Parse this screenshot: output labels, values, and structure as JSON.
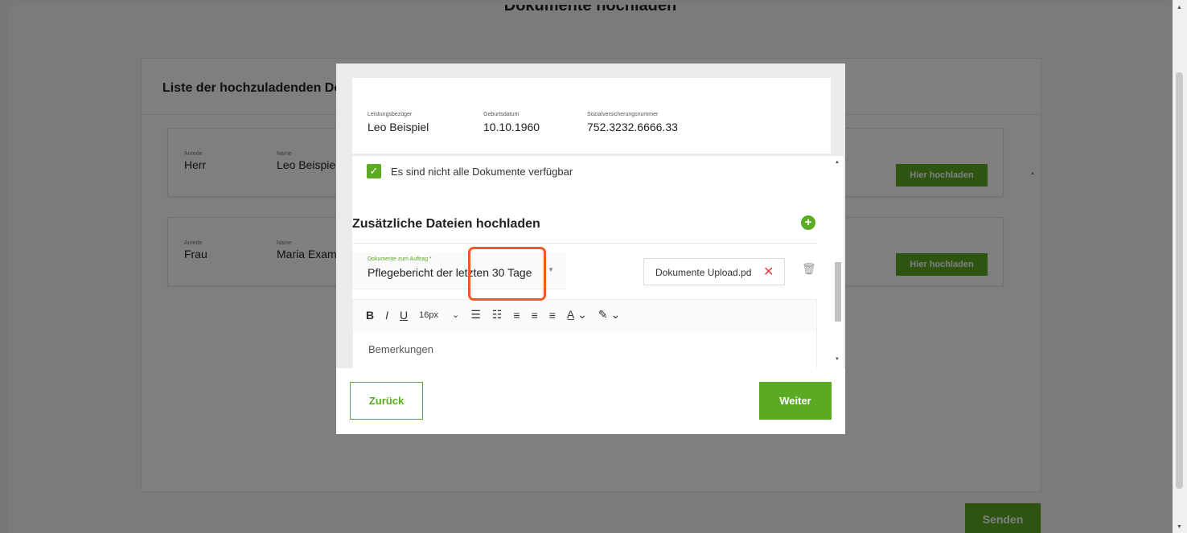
{
  "background": {
    "page_title": "Dokumente hochladen",
    "list_title": "Liste der hochzuladenden Dokumente",
    "rows": [
      {
        "anrede_label": "Anrede",
        "anrede": "Herr",
        "name_label": "Name",
        "name": "Leo Beispiel",
        "upload_label": "Hier hochladen"
      },
      {
        "anrede_label": "Anrede",
        "anrede": "Frau",
        "name_label": "Name",
        "name": "Maria Example",
        "upload_label": "Hier hochladen"
      }
    ],
    "send_label": "Senden"
  },
  "modal": {
    "recipient_label": "Leistungsbezüger",
    "recipient": "Leo Beispiel",
    "birthdate_label": "Geburtsdatum",
    "birthdate": "10.10.1960",
    "ssn_label": "Sozialversicherungsnummer",
    "ssn": "752.3232.6666.33",
    "checkbox_label": "Es sind nicht alle Dokumente verfügbar",
    "checkbox_checked": true,
    "section_title": "Zusätzliche Dateien hochladen",
    "select_label": "Dokumente zum Auftrag *",
    "select_value": "Pflegebericht der letzten 30 Tage",
    "file_name": "Dokumente Upload.pd",
    "toolbar": {
      "bold": "B",
      "italic": "I",
      "underline": "U",
      "font_size": "16px"
    },
    "editor_placeholder": "Bemerkungen",
    "back_label": "Zurück",
    "next_label": "Weiter"
  },
  "colors": {
    "accent": "#5aaa22",
    "highlight": "#f05a1e",
    "overlay": "rgba(0,0,0,0.5)",
    "remove": "#e04040"
  }
}
